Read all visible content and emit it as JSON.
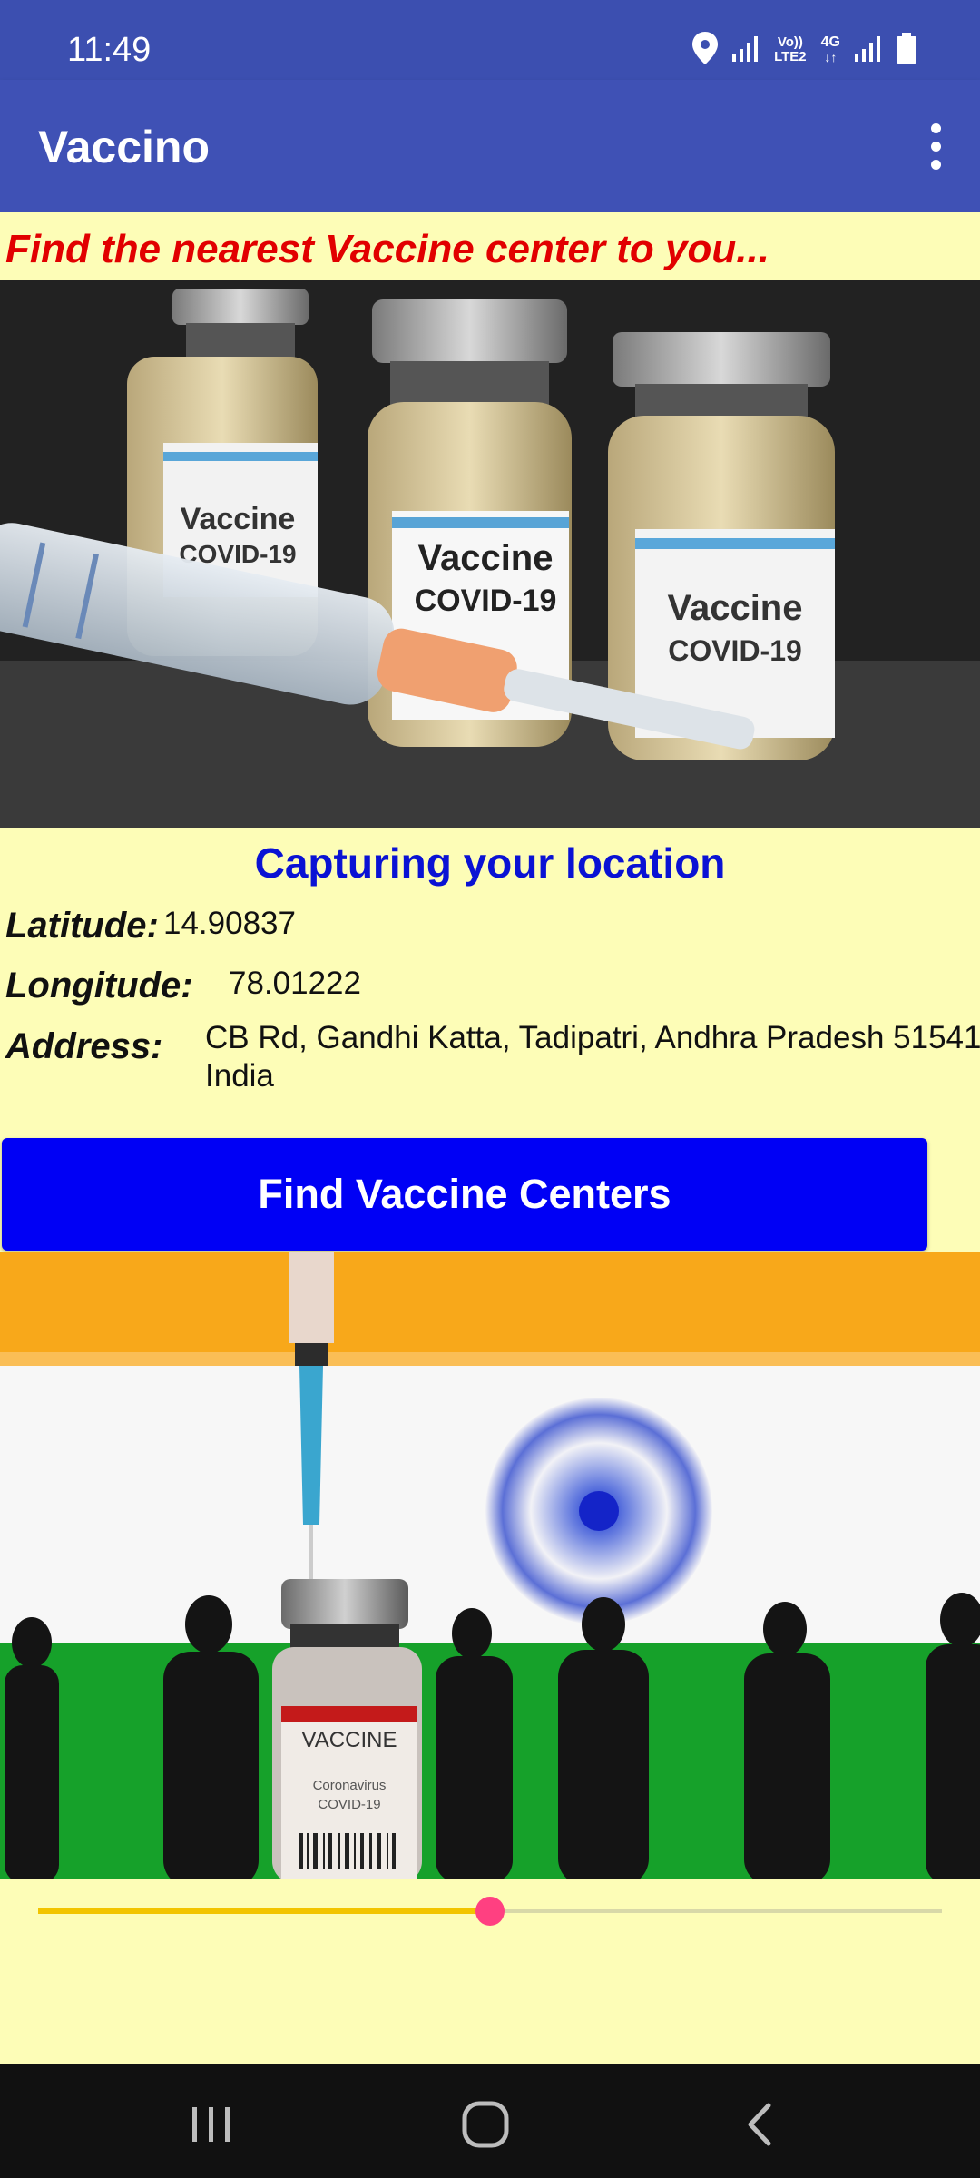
{
  "status_bar": {
    "time": "11:49",
    "network_label_top": "Vo))",
    "network_label_bottom": "LTE2",
    "data_label": "4G",
    "icons": [
      "location-icon",
      "signal-icon",
      "volte-icon",
      "data-4g-icon",
      "signal-icon",
      "battery-icon"
    ]
  },
  "app_bar": {
    "title": "Vaccino",
    "menu_icon": "more-vert-icon"
  },
  "main": {
    "headline": "Find the nearest Vaccine center to you...",
    "hero_image": {
      "vial_label_1": "Vaccine",
      "vial_label_2": "COVID-19"
    },
    "location_heading": "Capturing your location",
    "latitude_label": "Latitude:",
    "latitude_value": "14.90837",
    "longitude_label": "Longitude:",
    "longitude_value": "78.01222",
    "address_label": "Address:",
    "address_line1": "CB Rd, Gandhi Katta, Tadipatri, Andhra Pradesh 51541",
    "address_line2": "India",
    "find_button_label": "Find Vaccine Centers",
    "flag_image": {
      "vial_label_1": "VACCINE",
      "vial_label_2": "Coronavirus",
      "vial_label_3": "COVID-19"
    },
    "seekbar": {
      "progress": 0.5
    }
  },
  "nav_bar": {
    "icons": [
      "recent-apps-icon",
      "home-icon",
      "back-icon"
    ]
  },
  "colors": {
    "status_bar": "#3c4fb0",
    "app_bar": "#3f51b5",
    "background": "#fdfdb7",
    "headline": "#e10000",
    "location_heading": "#0a12d4",
    "button": "#0000f5",
    "seek_fill": "#f2c400",
    "seek_thumb": "#ff4081"
  }
}
